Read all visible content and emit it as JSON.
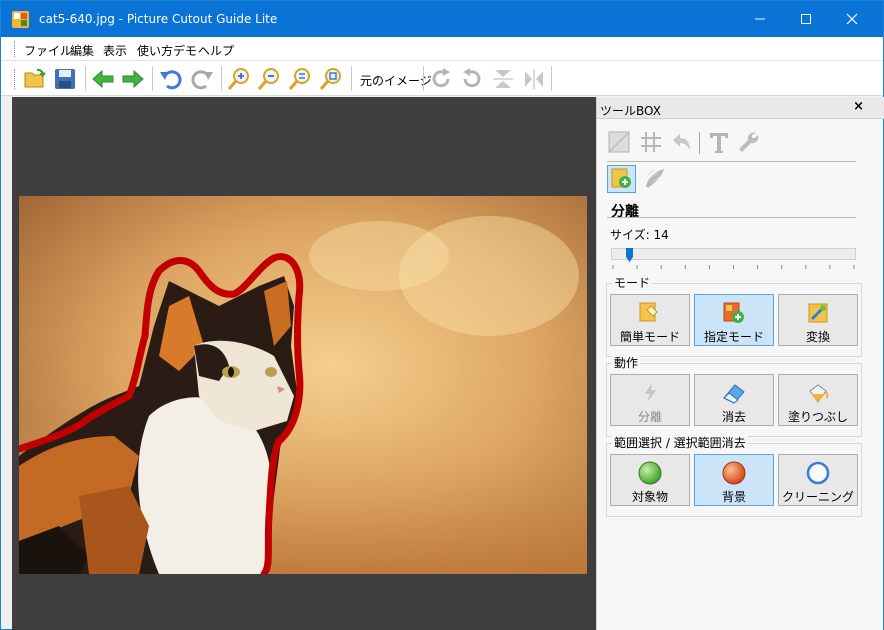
{
  "window": {
    "title": "cat5-640.jpg - Picture Cutout Guide Lite"
  },
  "menubar": {
    "items": [
      {
        "label": "ファイル"
      },
      {
        "label": "編集"
      },
      {
        "label": "表示"
      },
      {
        "label": "使い方デモ"
      },
      {
        "label": "ヘルプ"
      }
    ]
  },
  "toolbar": {
    "original_image_label": "元のイメージ",
    "icons": [
      "open-folder-icon",
      "save-icon",
      "back-arrow-icon",
      "forward-arrow-icon",
      "undo-icon",
      "redo-icon",
      "zoom-in-icon",
      "zoom-out-icon",
      "zoom-fit-icon",
      "zoom-actual-icon",
      "rotate-right-icon",
      "rotate-left-icon",
      "flip-vertical-icon",
      "flip-horizontal-icon"
    ]
  },
  "canvas": {
    "background": "#3e3e3e",
    "outline_color": "#d40000"
  },
  "toolbox": {
    "title": "ツールBOX",
    "close_label": "×",
    "section_title": "分離",
    "size_label": "サイズ: 14",
    "size_value": 14,
    "groups": [
      {
        "label": "モード",
        "buttons": [
          {
            "label": "簡単モード",
            "icon": "easy-mode-icon",
            "selected": false
          },
          {
            "label": "指定モード",
            "icon": "specify-mode-icon",
            "selected": true
          },
          {
            "label": "変換",
            "icon": "convert-icon",
            "selected": false
          }
        ]
      },
      {
        "label": "動作",
        "buttons": [
          {
            "label": "分離",
            "icon": "separate-icon",
            "selected": false,
            "disabled": true
          },
          {
            "label": "消去",
            "icon": "eraser-icon",
            "selected": false
          },
          {
            "label": "塗りつぶし",
            "icon": "paint-bucket-icon",
            "selected": false
          }
        ]
      },
      {
        "label": "範囲選択 / 選択範囲消去",
        "buttons": [
          {
            "label": "対象物",
            "icon": "green-circle-icon",
            "selected": false
          },
          {
            "label": "背景",
            "icon": "red-circle-icon",
            "selected": true
          },
          {
            "label": "クリーニング",
            "icon": "blue-ring-icon",
            "selected": false
          }
        ]
      }
    ]
  }
}
